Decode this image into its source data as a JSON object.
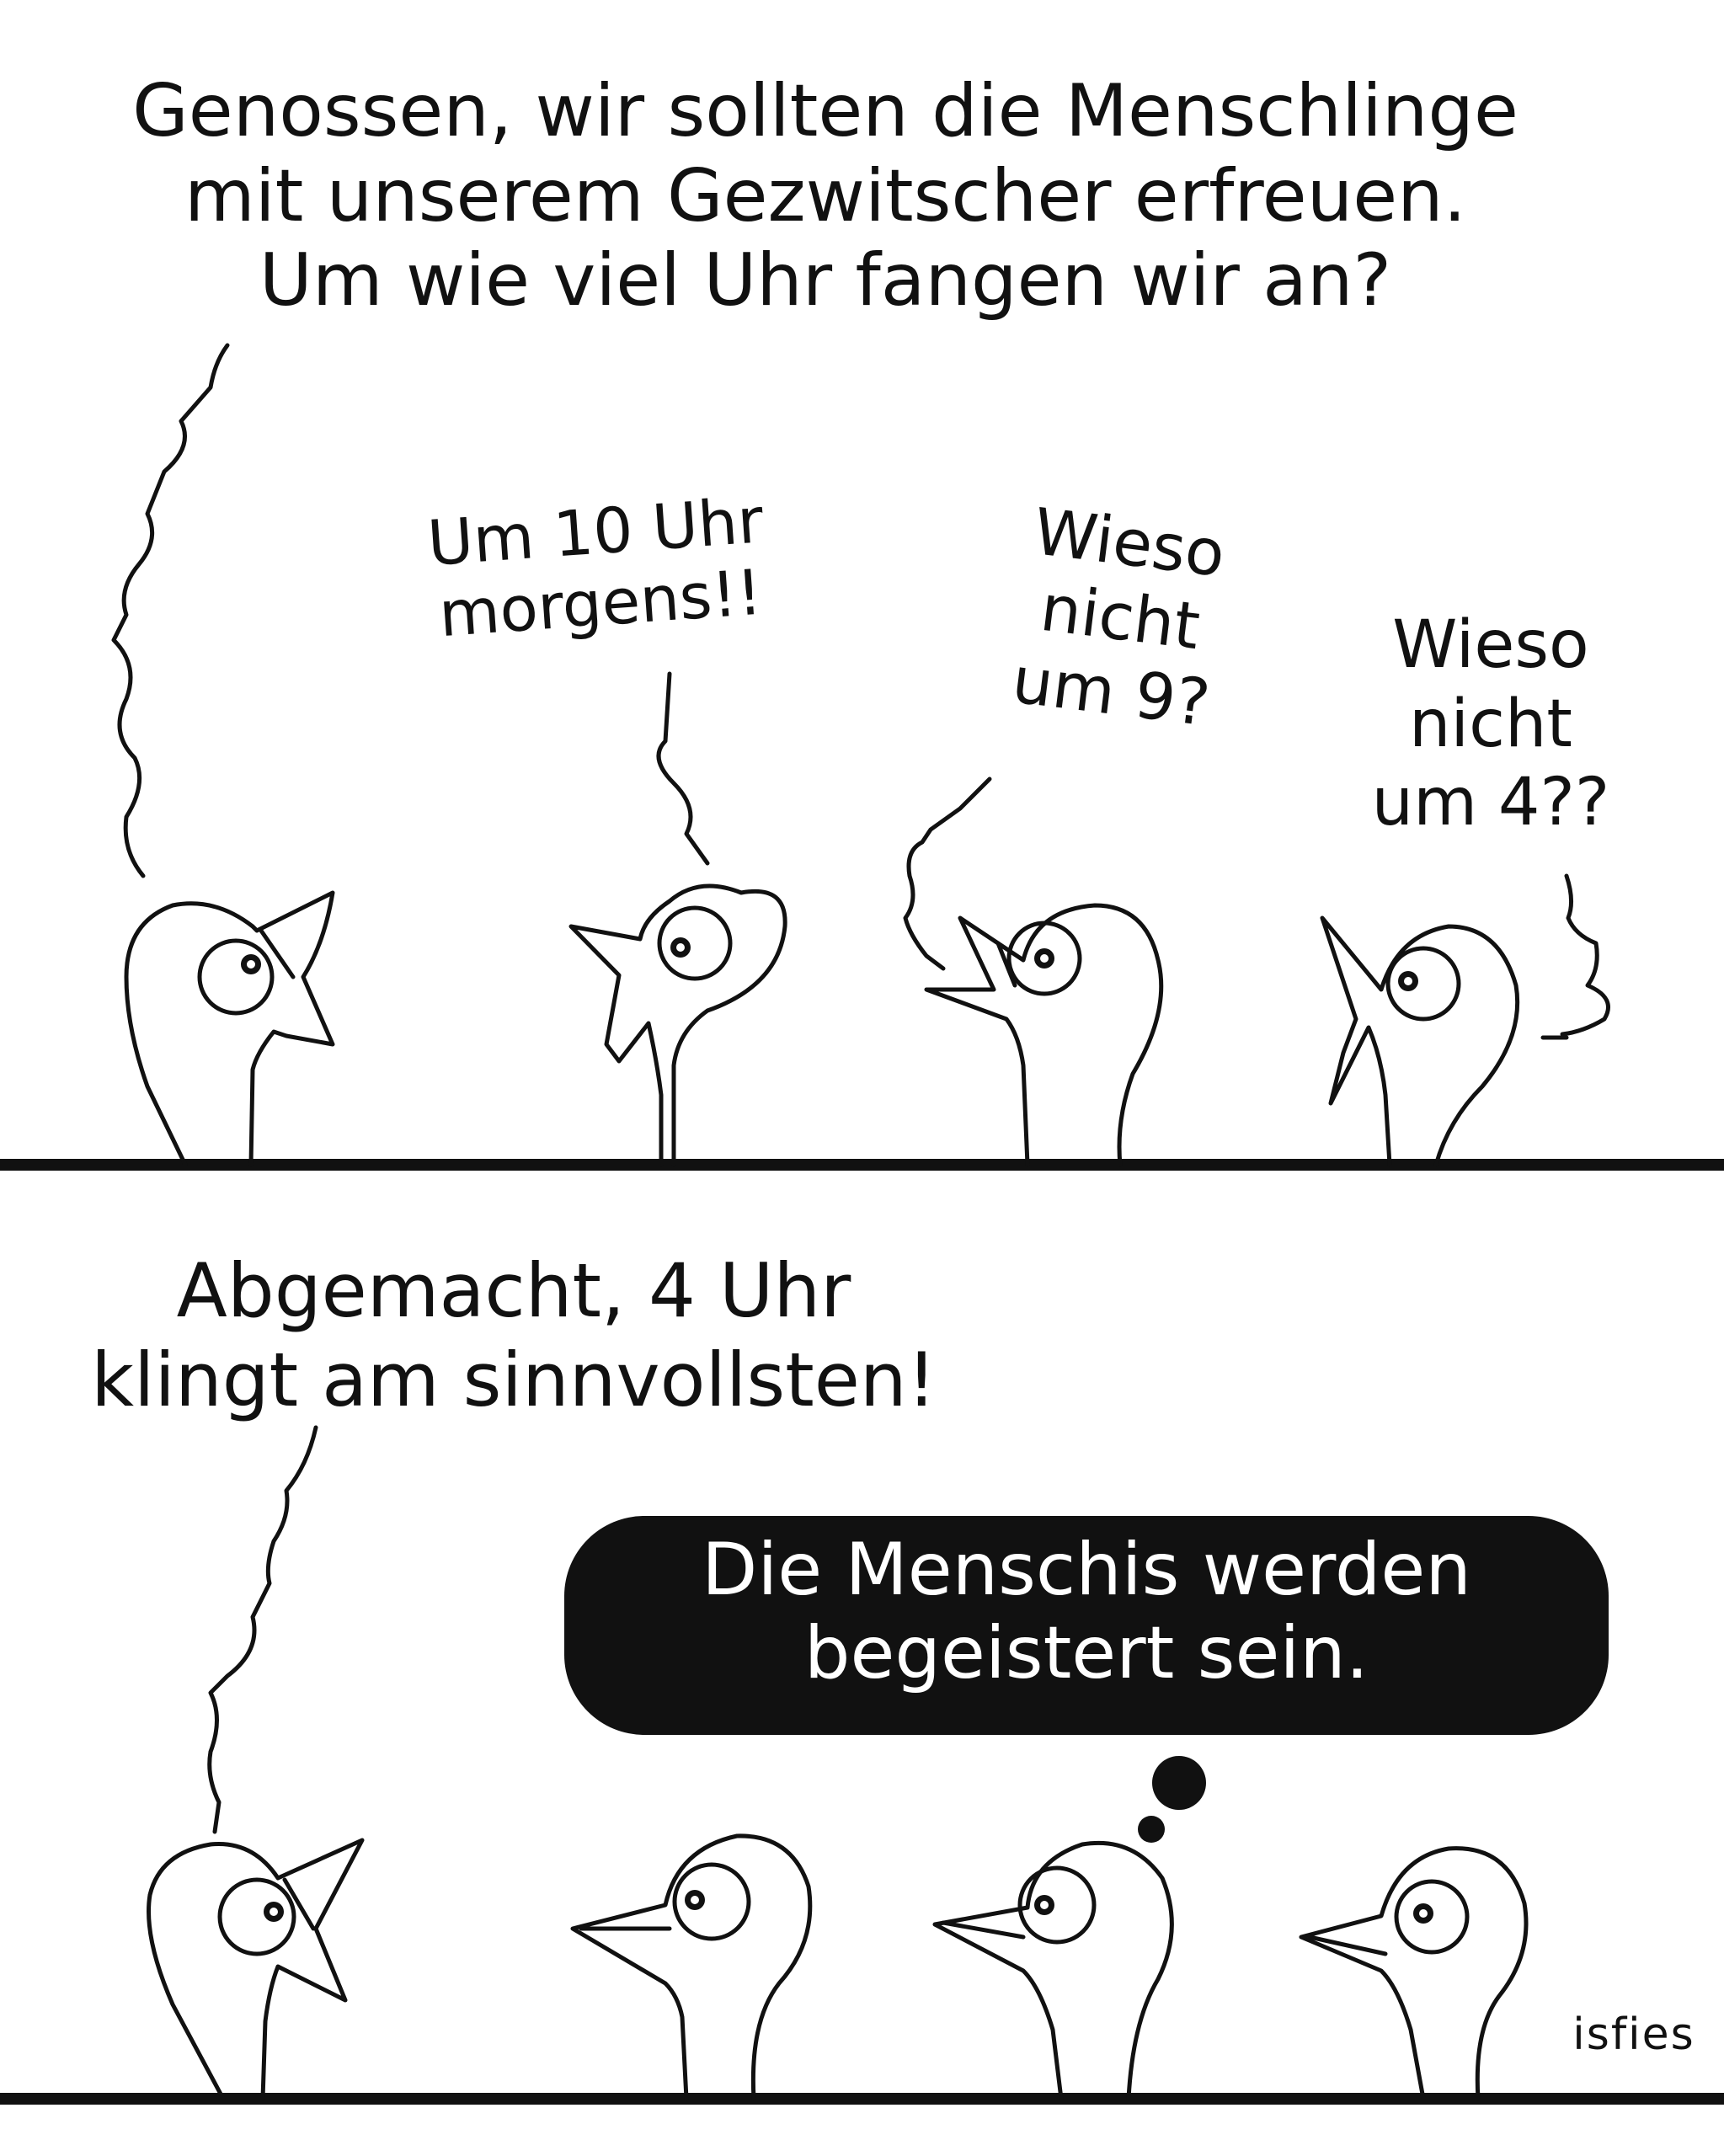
{
  "panel_top": {
    "speech_1": [
      "Genossen, wir sollten die Menschlinge",
      "mit unserem Gezwitscher erfreuen.",
      "Um wie viel Uhr fangen wir an?"
    ],
    "speech_2": [
      "Um 10 Uhr",
      "morgens!!"
    ],
    "speech_3": [
      "Wieso",
      "nicht",
      "um 9?"
    ],
    "speech_4": [
      "Wieso",
      "nicht",
      "um 4??"
    ]
  },
  "panel_bottom": {
    "speech_1": [
      "Abgemacht, 4 Uhr",
      "klingt am sinnvollsten!"
    ],
    "thought_bubble": [
      "Die Menschis werden",
      "begeistert sein."
    ]
  },
  "signature": "isfies",
  "colors": {
    "ink": "#111111",
    "paper": "#ffffff"
  }
}
